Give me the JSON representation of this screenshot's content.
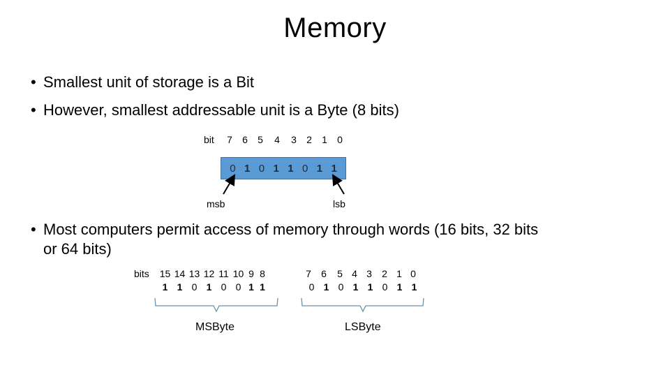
{
  "slide": {
    "title": "Memory",
    "bullets": [
      "Smallest unit of storage is a Bit",
      "However, smallest addressable unit is a Byte (8 bits)",
      "Most computers permit access of memory through words (16 bits, 32 bits",
      "or 64 bits)"
    ],
    "bullet_char": "•"
  },
  "byte_diagram": {
    "index_label": "bit",
    "indices": [
      "7",
      "6",
      "5",
      "4",
      "3",
      "2",
      "1",
      "0"
    ],
    "bits": [
      "0",
      "1",
      "0",
      "1",
      "1",
      "0",
      "1",
      "1"
    ],
    "msb_label": "msb",
    "lsb_label": "lsb",
    "box_color": "#5b9bd5",
    "border_color": "#41719c"
  },
  "word_diagram": {
    "index_label": "bits",
    "ms_indices": [
      "15",
      "14",
      "13",
      "12",
      "11",
      "10",
      "9",
      "8"
    ],
    "ms_bits": [
      "1",
      "1",
      "0",
      "1",
      "0",
      "0",
      "1",
      "1"
    ],
    "ls_indices": [
      "7",
      "6",
      "5",
      "4",
      "3",
      "2",
      "1",
      "0"
    ],
    "ls_bits": [
      "0",
      "1",
      "0",
      "1",
      "1",
      "0",
      "1",
      "1"
    ],
    "ms_label": "MSByte",
    "ls_label": "LSByte",
    "brace_color": "#6b8fa8"
  }
}
